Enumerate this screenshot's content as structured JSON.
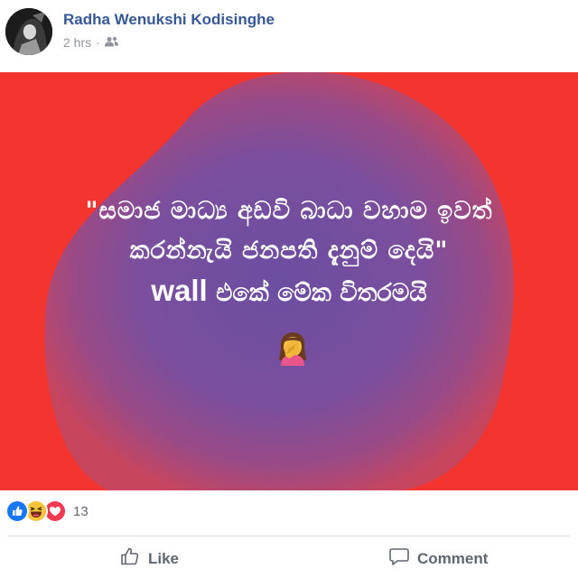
{
  "post": {
    "author": "Radha Wenukshi Kodisinghe",
    "time": "2 hrs",
    "separator": "·",
    "privacy_icon": "friends-icon",
    "background_color": "#f4352f",
    "blob_color": "#6a4fa0",
    "text_line1": "\"සමාජ මාධ්‍ය අඩවි බාධා වහාම ඉවත්",
    "text_line2": "කරන්නැයි ජනපති දැනුම් දෙයි\"",
    "text_line3_latin": "wall",
    "text_line3_sinhala": " එකේ මේක විතරමයි",
    "emoji": "facepalm-emoji"
  },
  "reactions": {
    "icons": [
      "like-reaction-icon",
      "haha-reaction-icon",
      "love-reaction-icon"
    ],
    "count": "13"
  },
  "actions": {
    "like_label": "Like",
    "comment_label": "Comment"
  }
}
